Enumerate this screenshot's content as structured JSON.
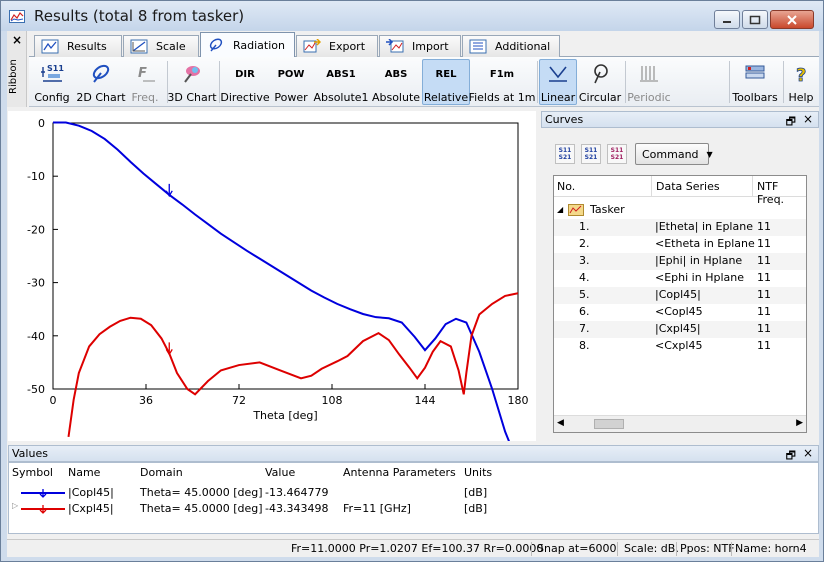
{
  "window": {
    "title": "Results (total 8 from tasker)"
  },
  "ribbon": {
    "close": "×",
    "side_label": "Ribbon"
  },
  "tabs": [
    {
      "label": "Results"
    },
    {
      "label": "Scale"
    },
    {
      "label": "Radiation"
    },
    {
      "label": "Export"
    },
    {
      "label": "Import"
    },
    {
      "label": "Additional"
    }
  ],
  "toolbar": [
    {
      "label": "Config",
      "icon_text": "S11",
      "icon": "config-icon"
    },
    {
      "label": "2D Chart",
      "icon": "2d-chart-icon"
    },
    {
      "label": "Freq.",
      "icon": "freq-icon"
    },
    {
      "label": "3D Chart",
      "icon": "3d-chart-icon"
    },
    {
      "label": "Directive",
      "icon_text": "DIR"
    },
    {
      "label": "Power",
      "icon_text": "POW"
    },
    {
      "label": "Absolute1",
      "icon_text": "ABS1"
    },
    {
      "label": "Absolute",
      "icon_text": "ABS"
    },
    {
      "label": "Relative",
      "icon_text": "REL"
    },
    {
      "label": "Fields at 1m",
      "icon_text": "F1m"
    },
    {
      "label": "Linear",
      "icon": "linear-icon"
    },
    {
      "label": "Circular",
      "icon": "circular-icon"
    },
    {
      "label": "Periodic",
      "icon": "periodic-icon"
    },
    {
      "label": "Toolbars",
      "icon": "toolbars-icon"
    },
    {
      "label": "Help",
      "icon": "help-icon"
    }
  ],
  "chart_data": {
    "type": "line",
    "xlabel": "Theta [deg]",
    "ylabel": "",
    "xlim": [
      0,
      180
    ],
    "ylim": [
      -50,
      0
    ],
    "xticks": [
      "0",
      "36",
      "72",
      "108",
      "144",
      "180"
    ],
    "yticks": [
      "0",
      "-10",
      "-20",
      "-30",
      "-40",
      "-50"
    ],
    "grid": false,
    "series": [
      {
        "name": "|Copl45|",
        "color": "#0000dd",
        "x": [
          0,
          5,
          10,
          15,
          20,
          25,
          30,
          35,
          40,
          45,
          50,
          55,
          60,
          65,
          70,
          75,
          80,
          85,
          90,
          95,
          100,
          105,
          110,
          115,
          120,
          125,
          130,
          135,
          140,
          144,
          148,
          152,
          156,
          160,
          165,
          170,
          175,
          180
        ],
        "y": [
          0.1,
          0.1,
          -0.5,
          -1.5,
          -3.0,
          -5.0,
          -7.3,
          -9.5,
          -11.5,
          -13.5,
          -15.3,
          -17.2,
          -19.0,
          -20.8,
          -22.4,
          -24.0,
          -25.5,
          -27.0,
          -28.5,
          -30.0,
          -31.5,
          -32.8,
          -34.0,
          -35.0,
          -35.9,
          -36.5,
          -36.7,
          -37.5,
          -40.2,
          -42.7,
          -40.5,
          -37.8,
          -36.8,
          -37.5,
          -43.0,
          -50.0,
          -58.0,
          -64.0
        ]
      },
      {
        "name": "|Cxpl45|",
        "color": "#dd0000",
        "x": [
          6,
          8,
          10,
          14,
          18,
          22,
          26,
          30,
          34,
          38,
          42,
          45,
          48,
          52,
          55,
          60,
          65,
          72,
          80,
          88,
          96,
          100,
          104,
          110,
          114,
          120,
          126,
          130,
          134,
          138,
          141,
          144,
          147,
          150,
          154,
          157,
          159,
          160,
          162,
          165,
          170,
          175,
          180
        ],
        "y": [
          -59.0,
          -52.0,
          -47.0,
          -42.0,
          -39.7,
          -38.3,
          -37.2,
          -36.6,
          -36.8,
          -38.0,
          -40.5,
          -43.3,
          -47.0,
          -50.0,
          -51.0,
          -48.5,
          -46.5,
          -45.5,
          -45.0,
          -46.5,
          -48.0,
          -47.5,
          -46.2,
          -44.8,
          -43.8,
          -41.0,
          -39.5,
          -40.8,
          -43.5,
          -46.0,
          -48.0,
          -46.0,
          -43.0,
          -41.0,
          -42.0,
          -46.5,
          -51.0,
          -47.0,
          -40.0,
          -36.0,
          -34.0,
          -32.5,
          -32.0
        ]
      }
    ],
    "markers_at_x": 45
  },
  "curves": {
    "title": "Curves",
    "pin": "🗗",
    "close": "×",
    "command_label": "Command",
    "columns": [
      "No.",
      "Data Series",
      "NTF Freq."
    ],
    "group": "Tasker",
    "rows": [
      {
        "no": "1.",
        "series": "|Etheta| in Eplane",
        "freq": "11"
      },
      {
        "no": "2.",
        "series": "<Etheta in Eplane",
        "freq": "11"
      },
      {
        "no": "3.",
        "series": "|Ephi| in Hplane",
        "freq": "11"
      },
      {
        "no": "4.",
        "series": "<Ephi in Hplane",
        "freq": "11"
      },
      {
        "no": "5.",
        "series": "|Copl45|",
        "freq": "11"
      },
      {
        "no": "6.",
        "series": "<Copl45",
        "freq": "11"
      },
      {
        "no": "7.",
        "series": "|Cxpl45|",
        "freq": "11"
      },
      {
        "no": "8.",
        "series": "<Cxpl45",
        "freq": "11"
      }
    ]
  },
  "values": {
    "title": "Values",
    "pin": "🗗",
    "close": "×",
    "columns": [
      "Symbol",
      "Name",
      "Domain",
      "Value",
      "Antenna Parameters",
      "Units"
    ],
    "rows": [
      {
        "name": "|Copl45|",
        "domain": "Theta= 45.0000 [deg]",
        "value": "-13.464779",
        "params": "",
        "units": "[dB]",
        "color": "#0000dd"
      },
      {
        "name": "|Cxpl45|",
        "domain": "Theta= 45.0000 [deg]",
        "value": "-43.343498",
        "params": "Fr=11 [GHz]",
        "units": "[dB]",
        "color": "#dd0000"
      }
    ]
  },
  "status": {
    "freq": "Fr=11.0000 Pr=1.0207 Ef=100.37 Rr=0.0000",
    "snap": "Snap at=6000",
    "scale": "Scale: dB.",
    "ppos": "Ppos: NTF",
    "name": "Name: horn4"
  }
}
